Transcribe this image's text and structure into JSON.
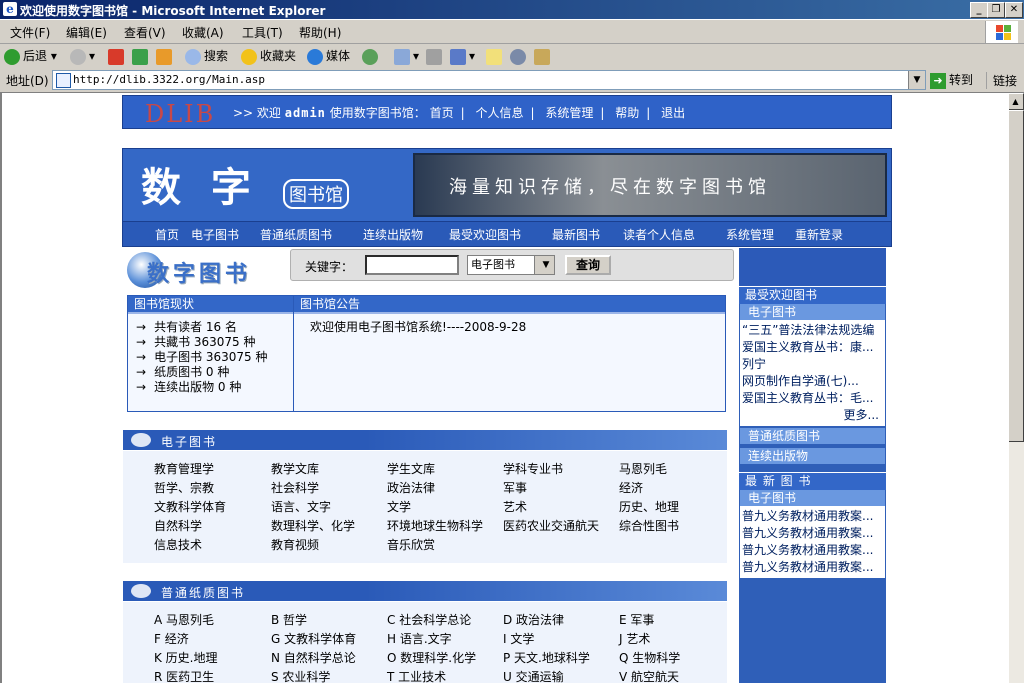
{
  "window": {
    "title": "欢迎使用数字图书馆 - Microsoft Internet Explorer",
    "buttons": [
      "_",
      "❐",
      "✕"
    ]
  },
  "menubar": [
    "文件(F)",
    "编辑(E)",
    "查看(V)",
    "收藏(A)",
    "工具(T)",
    "帮助(H)"
  ],
  "toolbar": {
    "back": "后退",
    "search": "搜索",
    "favorites": "收藏夹",
    "media": "媒体"
  },
  "address": {
    "label": "地址(D)",
    "url": "http://dlib.3322.org/Main.asp",
    "go": "转到",
    "links": "链接"
  },
  "top": {
    "logo": "DLIB",
    "welcome_prefix": ">> 欢迎",
    "user": "admin",
    "welcome_suffix": "使用数字图书馆：",
    "links": [
      "首页",
      "个人信息",
      "系统管理",
      "帮助",
      "退出"
    ]
  },
  "banner": {
    "title": "数 字",
    "subtitle": "图书馆",
    "slogan": "海量知识存储，尽在数字图书馆"
  },
  "mainnav": [
    "首页",
    "电子图书",
    "普通纸质图书",
    "连续出版物",
    "最受欢迎图书",
    "最新图书",
    "读者个人信息",
    "系统管理",
    "重新登录"
  ],
  "search": {
    "logo": "数字图书",
    "keyword_label": "关键字：",
    "keyword_value": "",
    "category": "电子图书",
    "button": "查询"
  },
  "status": {
    "title": "图书馆现状",
    "rows": [
      "共有读者 16 名",
      "共藏书 363075 种",
      "电子图书 363075 种",
      "纸质图书 0 种",
      "连续出版物 0 种"
    ]
  },
  "notice": {
    "title": "图书馆公告",
    "text": "欢迎使用电子图书馆系统!----2008-9-28"
  },
  "ebooks": {
    "title": "电子图书",
    "rows": [
      [
        "教育管理学",
        "教学文库",
        "学生文库",
        "学科专业书",
        "马恩列毛"
      ],
      [
        "哲学、宗教",
        "社会科学",
        "政治法律",
        "军事",
        "经济"
      ],
      [
        "文教科学体育",
        "语言、文字",
        "文学",
        "艺术",
        "历史、地理"
      ],
      [
        "自然科学",
        "数理科学、化学",
        "环境地球生物科学",
        "医药农业交通航天",
        "综合性图书"
      ],
      [
        "信息技术",
        "教育视频",
        "音乐欣赏",
        "",
        ""
      ]
    ]
  },
  "paperbooks": {
    "title": "普通纸质图书",
    "rows": [
      [
        "A 马恩列毛",
        "B 哲学",
        "C 社会科学总论",
        "D 政治法律",
        "E 军事"
      ],
      [
        "F 经济",
        "G 文教科学体育",
        "H 语言.文字",
        "I 文学",
        "J 艺术"
      ],
      [
        "K 历史.地理",
        "N 自然科学总论",
        "O 数理科学.化学",
        "P 天文.地球科学",
        "Q 生物科学"
      ],
      [
        "R 医药卫生",
        "S 农业科学",
        "T 工业技术",
        "U 交通运输",
        "V 航空航天"
      ]
    ]
  },
  "sidebar": {
    "popular_title": "最受欢迎图书",
    "popular_sub": "电子图书",
    "popular_items": [
      "“三五”普法法律法规选编",
      "爱国主义教育丛书：康...",
      "列宁",
      "网页制作自学通(七)...",
      "爱国主义教育丛书：毛..."
    ],
    "more": "更多...",
    "paper_link": "普通纸质图书",
    "serial_link": "连续出版物",
    "newest_title": "最 新 图 书",
    "newest_sub": "电子图书",
    "newest_items": [
      "普九义务教材通用教案...",
      "普九义务教材通用教案...",
      "普九义务教材通用教案...",
      "普九义务教材通用教案..."
    ]
  }
}
